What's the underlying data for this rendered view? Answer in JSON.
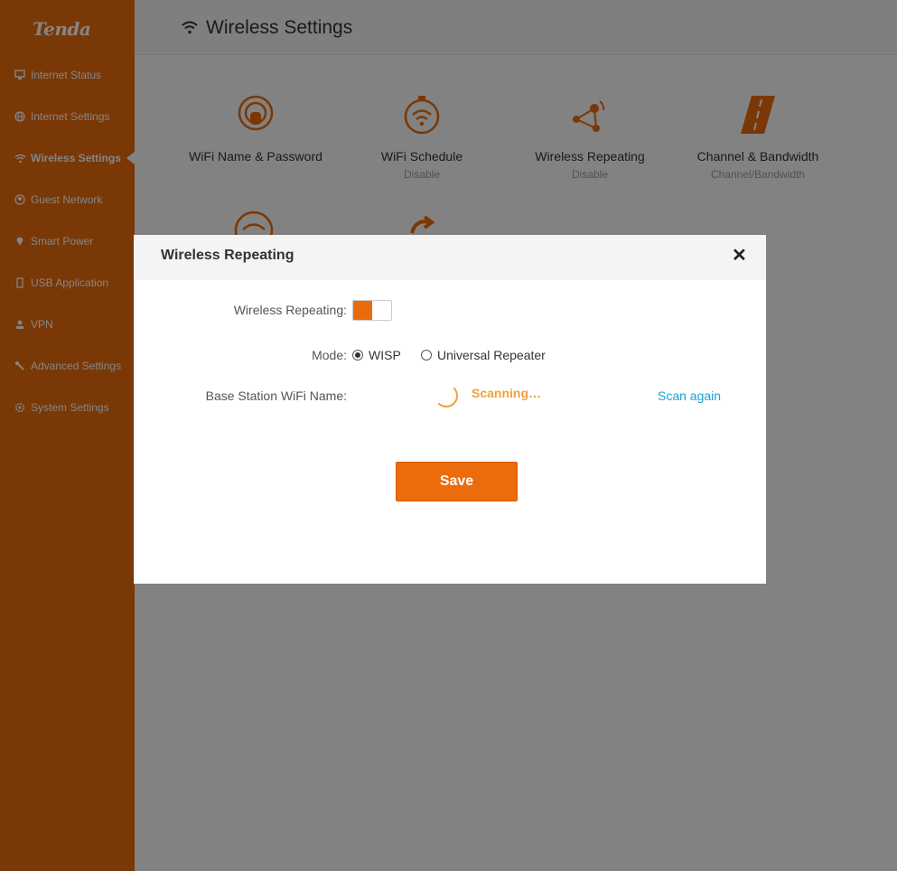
{
  "brand": {
    "logo_text": "Tenda",
    "accent_color": "#e96b0c"
  },
  "sidebar": {
    "items": [
      {
        "label": "Internet Status",
        "icon": "monitor-icon",
        "active": false
      },
      {
        "label": "Internet Settings",
        "icon": "globe-icon",
        "active": false
      },
      {
        "label": "Wireless Settings",
        "icon": "wifi-icon",
        "active": true
      },
      {
        "label": "Guest Network",
        "icon": "guest-icon",
        "active": false
      },
      {
        "label": "Smart Power",
        "icon": "pin-icon",
        "active": false
      },
      {
        "label": "USB Application",
        "icon": "usb-icon",
        "active": false
      },
      {
        "label": "VPN",
        "icon": "vpn-icon",
        "active": false
      },
      {
        "label": "Advanced Settings",
        "icon": "wrench-icon",
        "active": false
      },
      {
        "label": "System Settings",
        "icon": "gear-icon",
        "active": false
      }
    ]
  },
  "header": {
    "title": "Wireless Settings",
    "icon": "wifi-icon"
  },
  "tiles": [
    {
      "label": "WiFi Name & Password",
      "sub": "",
      "icon": "wifi-lock-icon"
    },
    {
      "label": "WiFi Schedule",
      "sub": "Disable",
      "icon": "wifi-timer-icon"
    },
    {
      "label": "Wireless Repeating",
      "sub": "Disable",
      "icon": "repeater-icon"
    },
    {
      "label": "Channel & Bandwidth",
      "sub": "Channel/Bandwidth",
      "icon": "road-icon"
    }
  ],
  "modal": {
    "title": "Wireless Repeating",
    "close_glyph": "✕",
    "repeating_label": "Wireless Repeating:",
    "repeating_enabled": true,
    "mode_label": "Mode:",
    "mode_options": [
      "WISP",
      "Universal Repeater"
    ],
    "mode_selected": "WISP",
    "base_station_label": "Base Station WiFi Name:",
    "scanning_text": "Scanning…",
    "scan_again": "Scan again",
    "save_label": "Save",
    "scanning_color": "#f0a040",
    "link_color": "#1a9fd8"
  }
}
